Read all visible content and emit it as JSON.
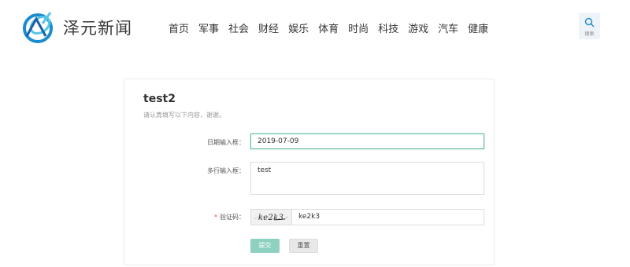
{
  "header": {
    "site_name": "泽元新闻",
    "nav": [
      {
        "label": "首页"
      },
      {
        "label": "军事"
      },
      {
        "label": "社会"
      },
      {
        "label": "财经"
      },
      {
        "label": "娱乐"
      },
      {
        "label": "体育"
      },
      {
        "label": "时尚"
      },
      {
        "label": "科技"
      },
      {
        "label": "游戏"
      },
      {
        "label": "汽车"
      },
      {
        "label": "健康"
      }
    ],
    "search_label": "搜索",
    "search_icon": "search-icon"
  },
  "form": {
    "title": "test2",
    "subtitle": "请认真填写以下内容，谢谢。",
    "date_label": "日期输入框：",
    "date_value": "2019-07-09",
    "textarea_label": "多行输入框：",
    "textarea_value": "test",
    "captcha_required_mark": "*",
    "captcha_label": "验证码：",
    "captcha_image_text": "ke2k3",
    "captcha_value": "ke2k3",
    "submit_label": "提交",
    "reset_label": "重置"
  },
  "colors": {
    "accent": "#5fb8a0",
    "submit_bg": "#8fd1c1",
    "required": "#e74c3c"
  }
}
